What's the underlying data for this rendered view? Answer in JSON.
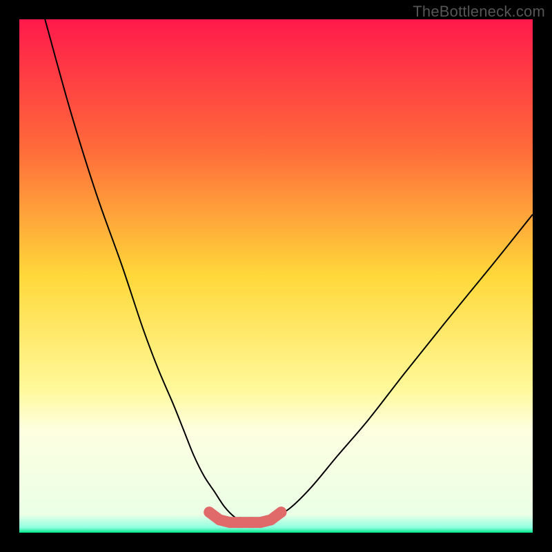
{
  "watermark": "TheBottleneck.com",
  "chart_data": {
    "type": "line",
    "title": "",
    "xlabel": "",
    "ylabel": "",
    "xlim": [
      0,
      100
    ],
    "ylim": [
      0,
      100
    ],
    "gradient_stops": [
      {
        "offset": 0,
        "color": "#ff1a4b"
      },
      {
        "offset": 0.25,
        "color": "#ff6a3a"
      },
      {
        "offset": 0.5,
        "color": "#ffd83a"
      },
      {
        "offset": 0.72,
        "color": "#fff99a"
      },
      {
        "offset": 0.8,
        "color": "#fdffe0"
      },
      {
        "offset": 0.965,
        "color": "#eaffe6"
      },
      {
        "offset": 0.99,
        "color": "#8fffe0"
      },
      {
        "offset": 1.0,
        "color": "#00e889"
      }
    ],
    "series": [
      {
        "name": "curve",
        "stroke": "#000000",
        "stroke_width": 2,
        "x": [
          5,
          10,
          15,
          20,
          24,
          27,
          30,
          32,
          34,
          36,
          38,
          40,
          42,
          44,
          46,
          48,
          50,
          53,
          57,
          62,
          68,
          75,
          83,
          92,
          100
        ],
        "y": [
          100,
          82,
          66,
          52,
          40,
          32,
          25,
          20,
          15,
          11,
          8,
          5,
          3,
          2,
          2,
          2,
          3,
          5,
          9,
          15,
          22,
          31,
          41,
          52,
          62
        ]
      },
      {
        "name": "bottom-markers",
        "type": "scatter",
        "color": "#e06a6a",
        "radius": 8,
        "x": [
          37,
          39,
          41,
          43,
          45,
          47,
          49,
          51
        ],
        "y": [
          4,
          2.5,
          2,
          2,
          2,
          2,
          2.5,
          4
        ]
      }
    ]
  }
}
